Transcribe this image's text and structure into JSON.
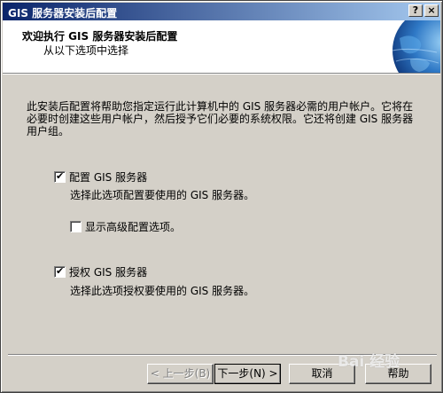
{
  "window": {
    "title": "GIS 服务器安装后配置",
    "help_glyph": "?",
    "close_glyph": "×"
  },
  "header": {
    "title": "欢迎执行 GIS 服务器安装后配置",
    "subtitle": "从以下选项中选择"
  },
  "intro_text": "此安装后配置将帮助您指定运行此计算机中的 GIS 服务器必需的用户帐户。它将在必要时创建这些用户帐户，然后授予它们必要的系统权限。它还将创建 GIS 服务器用户组。",
  "options": {
    "configure": {
      "label": "配置 GIS 服务器",
      "description": "选择此选项配置要使用的 GIS 服务器。",
      "checked": true
    },
    "advanced": {
      "label": "显示高级配置选项。",
      "checked": false
    },
    "authorize": {
      "label": "授权 GIS 服务器",
      "description": "选择此选项授权要使用的 GIS 服务器。",
      "checked": true
    }
  },
  "buttons": {
    "back": "< 上一步(B)",
    "next": "下一步(N) >",
    "cancel": "取消",
    "help": "帮助"
  },
  "watermark": "Bai 经验",
  "check_glyph": "✔",
  "colors": {
    "titlebar_start": "#0a246a",
    "titlebar_end": "#a6caf0",
    "dialog_face": "#d4d0c8"
  }
}
